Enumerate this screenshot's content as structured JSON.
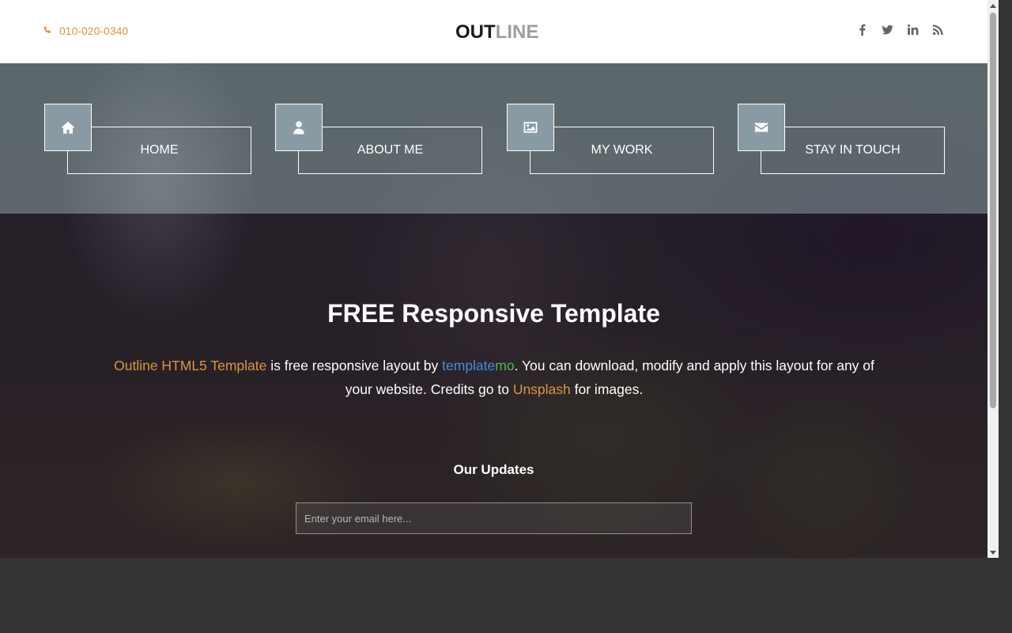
{
  "header": {
    "phone": "010-020-0340",
    "logo_part1": "OUT",
    "logo_part2": "LINE",
    "socials": [
      {
        "icon": "facebook-icon"
      },
      {
        "icon": "twitter-icon"
      },
      {
        "icon": "linkedin-icon"
      },
      {
        "icon": "rss-icon"
      }
    ]
  },
  "nav": [
    {
      "label": "HOME",
      "icon": "home-icon"
    },
    {
      "label": "ABOUT ME",
      "icon": "user-icon"
    },
    {
      "label": "MY WORK",
      "icon": "image-icon"
    },
    {
      "label": "STAY IN TOUCH",
      "icon": "envelope-icon"
    }
  ],
  "hero": {
    "title": "FREE Responsive Template",
    "text": {
      "link1": "Outline HTML5 Template",
      "part1": " is free responsive layout by ",
      "brand_a": "template",
      "brand_b": "mo",
      "part2": ". You can download, modify and apply this layout for any of your website. Credits go to ",
      "link2": "Unsplash",
      "part3": " for images."
    },
    "updates_title": "Our Updates",
    "email_placeholder": "Enter your email here..."
  },
  "colors": {
    "accent": "#d99542",
    "brand_blue": "#3f8fd8",
    "brand_green": "#55b54b",
    "nav_icon_bg": "#8a9aa3"
  }
}
